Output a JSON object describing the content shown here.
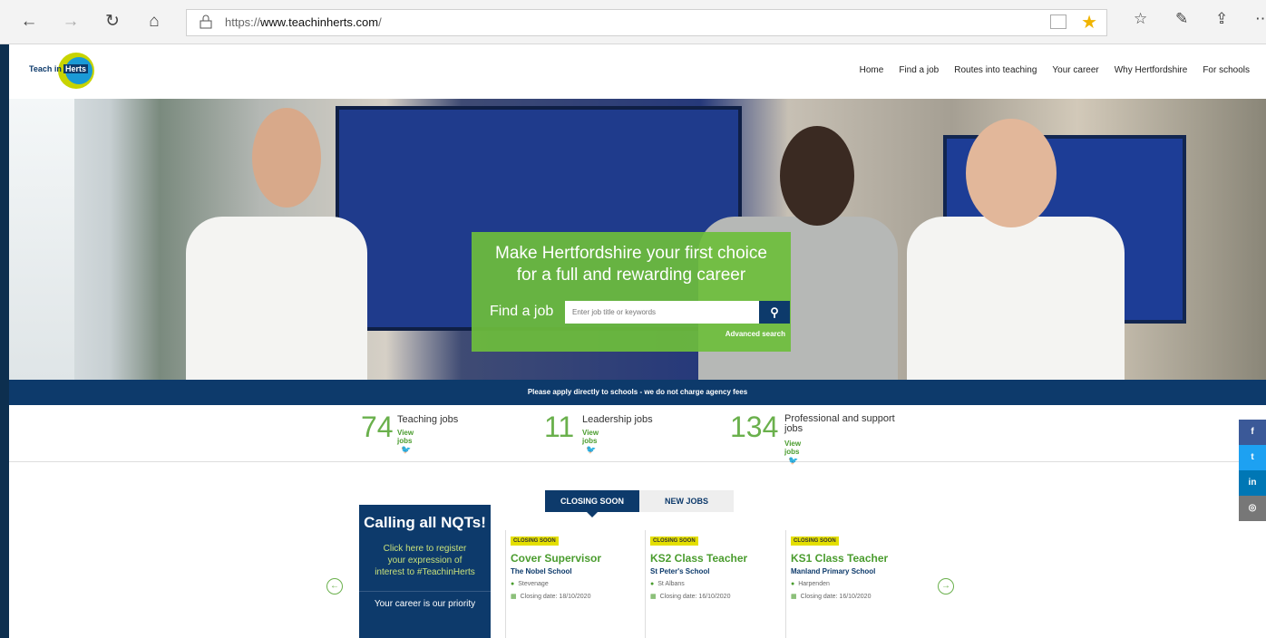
{
  "browser": {
    "url_prefix": "https://",
    "url_host": "www.teachinherts.com",
    "url_suffix": "/",
    "back_icon": "arrow-left-icon",
    "forward_icon": "arrow-right-icon",
    "refresh_icon": "refresh-icon",
    "home_icon": "home-icon",
    "favorite_icon": "star-icon",
    "favorite_color": "#f0b400"
  },
  "site": {
    "logo_text_1": "Teach in",
    "logo_text_2": "Herts",
    "nav": [
      "Home",
      "Find a job",
      "Routes into teaching",
      "Your career",
      "Why Hertfordshire",
      "For schools"
    ]
  },
  "hero": {
    "headline_1": "Make Hertfordshire your first choice",
    "headline_2": "for a full and rewarding career",
    "find_label": "Find a job",
    "search_placeholder": "Enter job title or keywords",
    "advanced_search": "Advanced search",
    "accent": "#6ebe3c"
  },
  "notice": "Please apply directly to schools - we do not charge agency fees",
  "stats": [
    {
      "count": "74",
      "label": "Teaching jobs",
      "link": "View jobs"
    },
    {
      "count": "11",
      "label": "Leadership jobs",
      "link": "View jobs"
    },
    {
      "count": "134",
      "label": "Professional and support jobs",
      "link": "View jobs"
    }
  ],
  "tabs": [
    "CLOSING SOON",
    "NEW JOBS"
  ],
  "promo": {
    "title": "Calling all NQTs!",
    "line_1": "Click here to register",
    "line_2": "your expression of",
    "line_3": "interest to #TeachinHerts",
    "tagline": "Your career is our priority"
  },
  "jobs": [
    {
      "badge": "CLOSING SOON",
      "title": "Cover Supervisor",
      "school": "The Nobel School",
      "location": "Stevenage",
      "closing": "Closing date: 18/10/2020"
    },
    {
      "badge": "CLOSING SOON",
      "title": "KS2 Class Teacher",
      "school": "St Peter's School",
      "location": "St Albans",
      "closing": "Closing date: 16/10/2020"
    },
    {
      "badge": "CLOSING SOON",
      "title": "KS1 Class Teacher",
      "school": "Manland Primary School",
      "location": "Harpenden",
      "closing": "Closing date: 16/10/2020"
    }
  ],
  "social": [
    {
      "label": "f",
      "color": "#3b5998"
    },
    {
      "label": "t",
      "color": "#1da1f2"
    },
    {
      "label": "in",
      "color": "#0077b5"
    },
    {
      "label": "◎",
      "color": "#777777"
    }
  ],
  "colors": {
    "navy": "#0d3a6b",
    "green": "#6ab04c",
    "badge": "#e4df00"
  }
}
